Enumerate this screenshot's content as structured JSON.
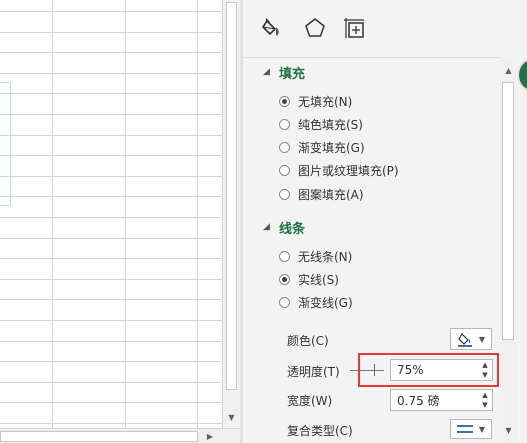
{
  "pane": {
    "tabs": [
      {
        "name": "fill-line",
        "icon": "paint-bucket-icon"
      },
      {
        "name": "effects",
        "icon": "pentagon-icon"
      },
      {
        "name": "size-properties",
        "icon": "size-properties-icon"
      }
    ],
    "fill": {
      "title": "填充",
      "options": [
        {
          "label": "无填充(N)",
          "checked": true
        },
        {
          "label": "纯色填充(S)",
          "checked": false
        },
        {
          "label": "渐变填充(G)",
          "checked": false
        },
        {
          "label": "图片或纹理填充(P)",
          "checked": false
        },
        {
          "label": "图案填充(A)",
          "checked": false
        }
      ]
    },
    "line": {
      "title": "线条",
      "options": [
        {
          "label": "无线条(N)",
          "checked": false
        },
        {
          "label": "实线(S)",
          "checked": true
        },
        {
          "label": "渐变线(G)",
          "checked": false
        }
      ],
      "color_label": "颜色(C)",
      "transparency_label": "透明度(T)",
      "transparency_value": "75%",
      "width_label": "宽度(W)",
      "width_value": "0.75 磅",
      "compound_label": "复合类型(C)"
    }
  },
  "colors": {
    "accent_green": "#217346",
    "highlight_red": "#e53935"
  }
}
